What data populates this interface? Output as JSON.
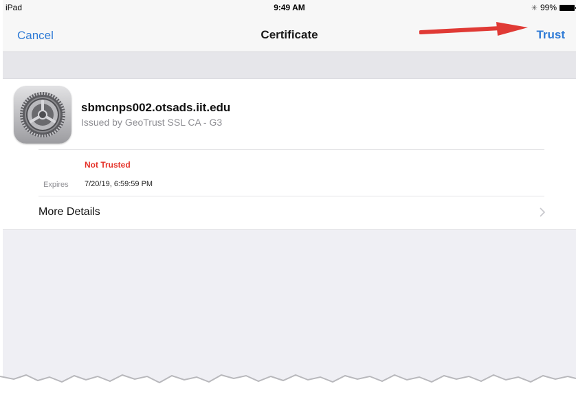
{
  "status_bar": {
    "carrier": "iPad",
    "time": "9:49 AM",
    "battery": "99%"
  },
  "nav": {
    "cancel_label": "Cancel",
    "title": "Certificate",
    "trust_label": "Trust"
  },
  "certificate": {
    "name": "sbmcnps002.otsads.iit.edu",
    "issuer": "Issued by GeoTrust SSL CA - G3",
    "trust_status": "Not Trusted",
    "expires_label": "Expires",
    "expires_value": "7/20/19, 6:59:59 PM"
  },
  "more_details_label": "More Details",
  "colors": {
    "accent": "#2f7bd6",
    "warning": "#e5332a",
    "annotation_arrow": "#e03a35"
  },
  "icons": [
    "bluetooth-icon",
    "battery-icon",
    "settings-gear-icon",
    "chevron-right-icon",
    "red-arrow-annotation"
  ]
}
